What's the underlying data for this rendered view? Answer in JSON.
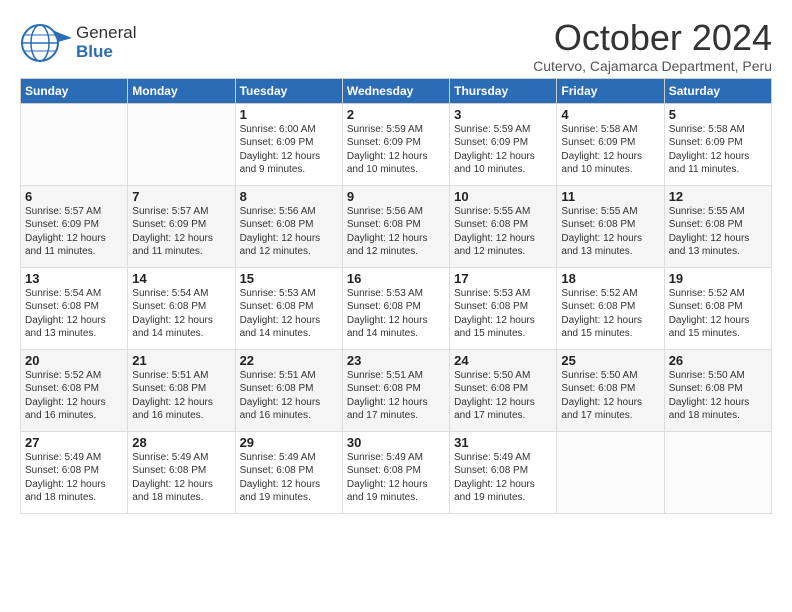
{
  "logo": {
    "general": "General",
    "blue": "Blue"
  },
  "title": "October 2024",
  "subtitle": "Cutervo, Cajamarca Department, Peru",
  "days_of_week": [
    "Sunday",
    "Monday",
    "Tuesday",
    "Wednesday",
    "Thursday",
    "Friday",
    "Saturday"
  ],
  "weeks": [
    [
      {
        "day": "",
        "info": ""
      },
      {
        "day": "",
        "info": ""
      },
      {
        "day": "1",
        "info": "Sunrise: 6:00 AM\nSunset: 6:09 PM\nDaylight: 12 hours\nand 9 minutes."
      },
      {
        "day": "2",
        "info": "Sunrise: 5:59 AM\nSunset: 6:09 PM\nDaylight: 12 hours\nand 10 minutes."
      },
      {
        "day": "3",
        "info": "Sunrise: 5:59 AM\nSunset: 6:09 PM\nDaylight: 12 hours\nand 10 minutes."
      },
      {
        "day": "4",
        "info": "Sunrise: 5:58 AM\nSunset: 6:09 PM\nDaylight: 12 hours\nand 10 minutes."
      },
      {
        "day": "5",
        "info": "Sunrise: 5:58 AM\nSunset: 6:09 PM\nDaylight: 12 hours\nand 11 minutes."
      }
    ],
    [
      {
        "day": "6",
        "info": "Sunrise: 5:57 AM\nSunset: 6:09 PM\nDaylight: 12 hours\nand 11 minutes."
      },
      {
        "day": "7",
        "info": "Sunrise: 5:57 AM\nSunset: 6:09 PM\nDaylight: 12 hours\nand 11 minutes."
      },
      {
        "day": "8",
        "info": "Sunrise: 5:56 AM\nSunset: 6:08 PM\nDaylight: 12 hours\nand 12 minutes."
      },
      {
        "day": "9",
        "info": "Sunrise: 5:56 AM\nSunset: 6:08 PM\nDaylight: 12 hours\nand 12 minutes."
      },
      {
        "day": "10",
        "info": "Sunrise: 5:55 AM\nSunset: 6:08 PM\nDaylight: 12 hours\nand 12 minutes."
      },
      {
        "day": "11",
        "info": "Sunrise: 5:55 AM\nSunset: 6:08 PM\nDaylight: 12 hours\nand 13 minutes."
      },
      {
        "day": "12",
        "info": "Sunrise: 5:55 AM\nSunset: 6:08 PM\nDaylight: 12 hours\nand 13 minutes."
      }
    ],
    [
      {
        "day": "13",
        "info": "Sunrise: 5:54 AM\nSunset: 6:08 PM\nDaylight: 12 hours\nand 13 minutes."
      },
      {
        "day": "14",
        "info": "Sunrise: 5:54 AM\nSunset: 6:08 PM\nDaylight: 12 hours\nand 14 minutes."
      },
      {
        "day": "15",
        "info": "Sunrise: 5:53 AM\nSunset: 6:08 PM\nDaylight: 12 hours\nand 14 minutes."
      },
      {
        "day": "16",
        "info": "Sunrise: 5:53 AM\nSunset: 6:08 PM\nDaylight: 12 hours\nand 14 minutes."
      },
      {
        "day": "17",
        "info": "Sunrise: 5:53 AM\nSunset: 6:08 PM\nDaylight: 12 hours\nand 15 minutes."
      },
      {
        "day": "18",
        "info": "Sunrise: 5:52 AM\nSunset: 6:08 PM\nDaylight: 12 hours\nand 15 minutes."
      },
      {
        "day": "19",
        "info": "Sunrise: 5:52 AM\nSunset: 6:08 PM\nDaylight: 12 hours\nand 15 minutes."
      }
    ],
    [
      {
        "day": "20",
        "info": "Sunrise: 5:52 AM\nSunset: 6:08 PM\nDaylight: 12 hours\nand 16 minutes."
      },
      {
        "day": "21",
        "info": "Sunrise: 5:51 AM\nSunset: 6:08 PM\nDaylight: 12 hours\nand 16 minutes."
      },
      {
        "day": "22",
        "info": "Sunrise: 5:51 AM\nSunset: 6:08 PM\nDaylight: 12 hours\nand 16 minutes."
      },
      {
        "day": "23",
        "info": "Sunrise: 5:51 AM\nSunset: 6:08 PM\nDaylight: 12 hours\nand 17 minutes."
      },
      {
        "day": "24",
        "info": "Sunrise: 5:50 AM\nSunset: 6:08 PM\nDaylight: 12 hours\nand 17 minutes."
      },
      {
        "day": "25",
        "info": "Sunrise: 5:50 AM\nSunset: 6:08 PM\nDaylight: 12 hours\nand 17 minutes."
      },
      {
        "day": "26",
        "info": "Sunrise: 5:50 AM\nSunset: 6:08 PM\nDaylight: 12 hours\nand 18 minutes."
      }
    ],
    [
      {
        "day": "27",
        "info": "Sunrise: 5:49 AM\nSunset: 6:08 PM\nDaylight: 12 hours\nand 18 minutes."
      },
      {
        "day": "28",
        "info": "Sunrise: 5:49 AM\nSunset: 6:08 PM\nDaylight: 12 hours\nand 18 minutes."
      },
      {
        "day": "29",
        "info": "Sunrise: 5:49 AM\nSunset: 6:08 PM\nDaylight: 12 hours\nand 19 minutes."
      },
      {
        "day": "30",
        "info": "Sunrise: 5:49 AM\nSunset: 6:08 PM\nDaylight: 12 hours\nand 19 minutes."
      },
      {
        "day": "31",
        "info": "Sunrise: 5:49 AM\nSunset: 6:08 PM\nDaylight: 12 hours\nand 19 minutes."
      },
      {
        "day": "",
        "info": ""
      },
      {
        "day": "",
        "info": ""
      }
    ]
  ]
}
